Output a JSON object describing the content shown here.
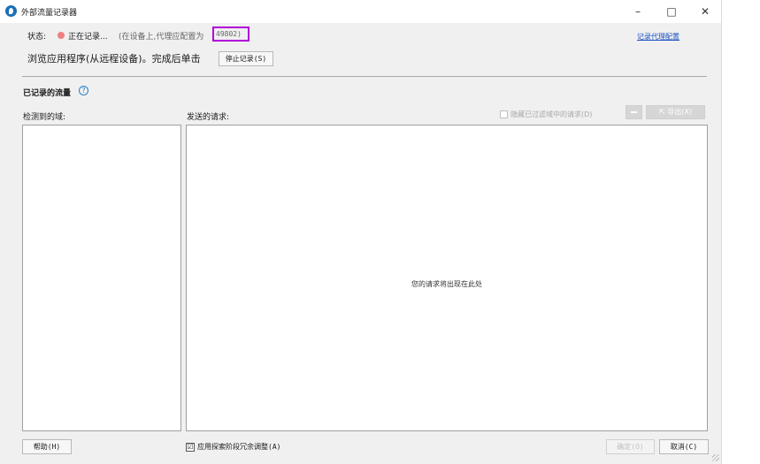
{
  "window": {
    "title": "外部流量记录器",
    "controls": {
      "minimize": "–",
      "maximize": "□",
      "close": "✕"
    }
  },
  "status": {
    "label": "状态:",
    "recording": "正在记录...",
    "note": "(在设备上,代理应配置为",
    "port": "49802)",
    "config_link": "记录代理配置",
    "browse_text": "浏览应用程序(从远程设备)。完成后单击",
    "stop_button": "停止记录(S)"
  },
  "recorded": {
    "title": "已记录的流量",
    "help_icon": "?",
    "domains_label": "检测到的域:",
    "requests_label": "发送的请求:",
    "hide_filtered_label": "隐藏已过滤域中的请求(D)",
    "export_button": "导出(X)",
    "empty_message": "您的请求将出现在此处"
  },
  "footer": {
    "help_button": "帮助(H)",
    "adjust_label": "应用探索阶段冗余调整(A)",
    "adjust_checked": "☑",
    "ok_button": "确定(O)",
    "cancel_button": "取消(C)"
  },
  "colors": {
    "recording_dot": "#f08080",
    "port_highlight": "#b000d8",
    "link": "#1a4fc4"
  }
}
